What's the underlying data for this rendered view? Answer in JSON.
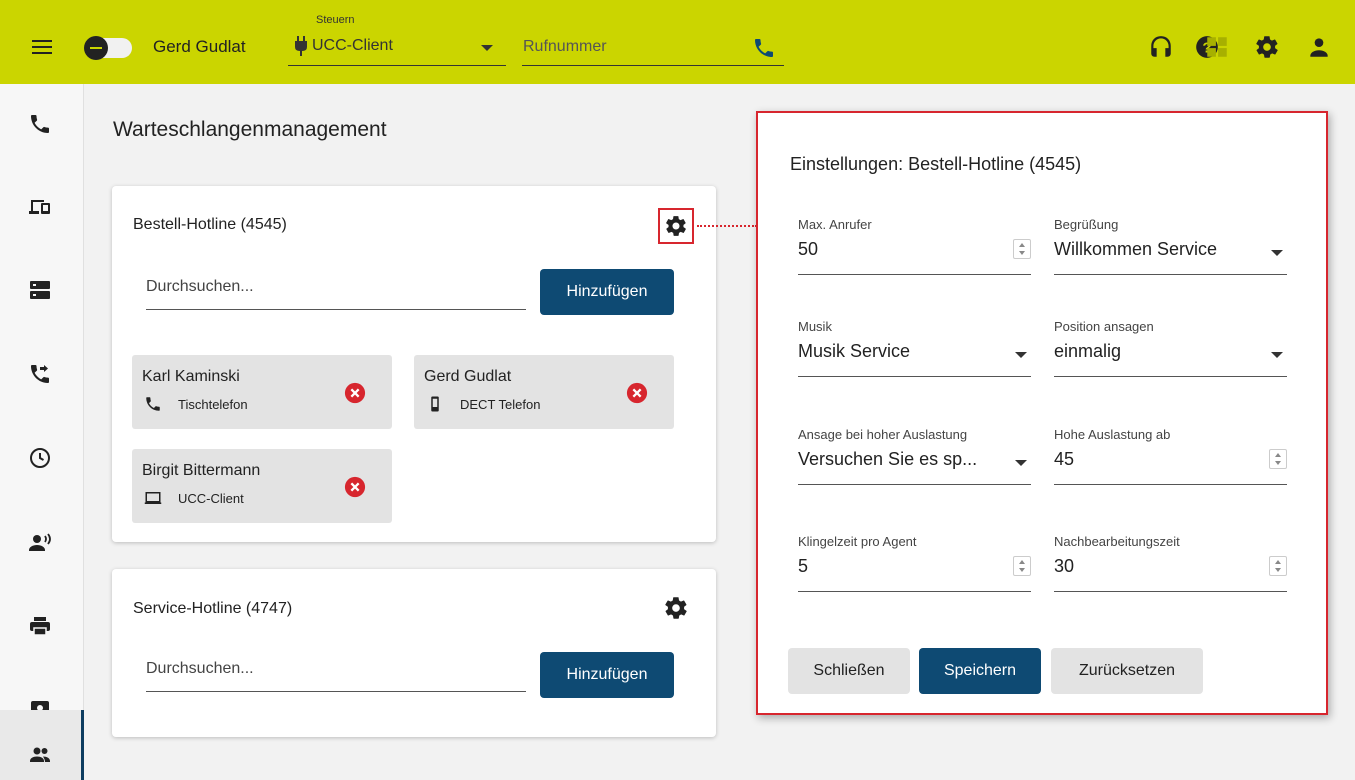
{
  "header": {
    "user_name": "Gerd Gudlat",
    "control_label": "Steuern",
    "device_value": "UCC-Client",
    "phone_placeholder": "Rufnummer",
    "icons": [
      "headset-icon",
      "help-icon",
      "grid-icon",
      "gear-icon",
      "person-icon"
    ]
  },
  "nav": {
    "items": [
      "phone-icon",
      "devices-icon",
      "server-icon",
      "call-forward-icon",
      "history-icon",
      "voicemail-icon",
      "printer-icon",
      "contact-card-icon",
      "group-icon"
    ],
    "active": "group-icon"
  },
  "main": {
    "title": "Warteschlangenmanagement",
    "queues": [
      {
        "title": "Bestell-Hotline (4545)",
        "search_placeholder": "Durchsuchen...",
        "add_label": "Hinzufügen",
        "members": [
          {
            "name": "Karl Kaminski",
            "device": "Tischtelefon",
            "device_icon": "phone-icon"
          },
          {
            "name": "Gerd Gudlat",
            "device": "DECT Telefon",
            "device_icon": "mobile-icon"
          },
          {
            "name": "Birgit Bittermann",
            "device": "UCC-Client",
            "device_icon": "laptop-icon"
          }
        ]
      },
      {
        "title": "Service-Hotline (4747)",
        "search_placeholder": "Durchsuchen...",
        "add_label": "Hinzufügen"
      }
    ]
  },
  "dialog": {
    "title": "Einstellungen: Bestell-Hotline (4545)",
    "fields": [
      {
        "label": "Max. Anrufer",
        "value": "50",
        "kind": "number"
      },
      {
        "label": "Begrüßung",
        "value": "Willkommen Service",
        "kind": "select"
      },
      {
        "label": "Musik",
        "value": "Musik Service",
        "kind": "select"
      },
      {
        "label": "Position ansagen",
        "value": "einmalig",
        "kind": "select"
      },
      {
        "label": "Ansage bei hoher Auslastung",
        "value": "Versuchen Sie es sp...",
        "kind": "select"
      },
      {
        "label": "Hohe Auslastung ab",
        "value": "45",
        "kind": "number"
      },
      {
        "label": "Klingelzeit pro Agent",
        "value": "5",
        "kind": "number"
      },
      {
        "label": "Nachbearbeitungszeit",
        "value": "30",
        "kind": "number"
      }
    ],
    "buttons": {
      "close": "Schließen",
      "save": "Speichern",
      "reset": "Zurücksetzen"
    }
  },
  "colors": {
    "topbar": "#cbd500",
    "primary": "#0e4a73",
    "highlight": "#d7262e",
    "remove": "#d7262e"
  }
}
